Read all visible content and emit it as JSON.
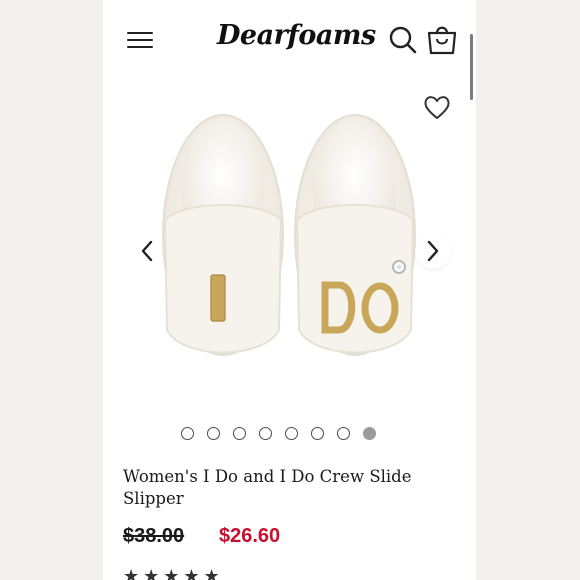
{
  "header": {
    "brand": "Dearfoams",
    "menu_icon": "hamburger-menu-icon",
    "search_icon": "search-icon",
    "cart_icon": "shopping-bag-icon"
  },
  "gallery": {
    "favorite_icon": "heart-icon",
    "prev_icon": "chevron-left-icon",
    "next_icon": "chevron-right-icon",
    "image_letters_left": "I",
    "image_letters_right": "DO",
    "total_images": 8,
    "active_image": 8
  },
  "product": {
    "title": "Women's I Do and I Do Crew Slide Slipper",
    "original_price": "$38.00",
    "sale_price": "$26.60",
    "stars": "★★★★★"
  },
  "colors": {
    "sale": "#c8102e",
    "text": "#1a1a1a",
    "slipper": "#f4f1ea",
    "letters_gold": "#c9a75a"
  }
}
